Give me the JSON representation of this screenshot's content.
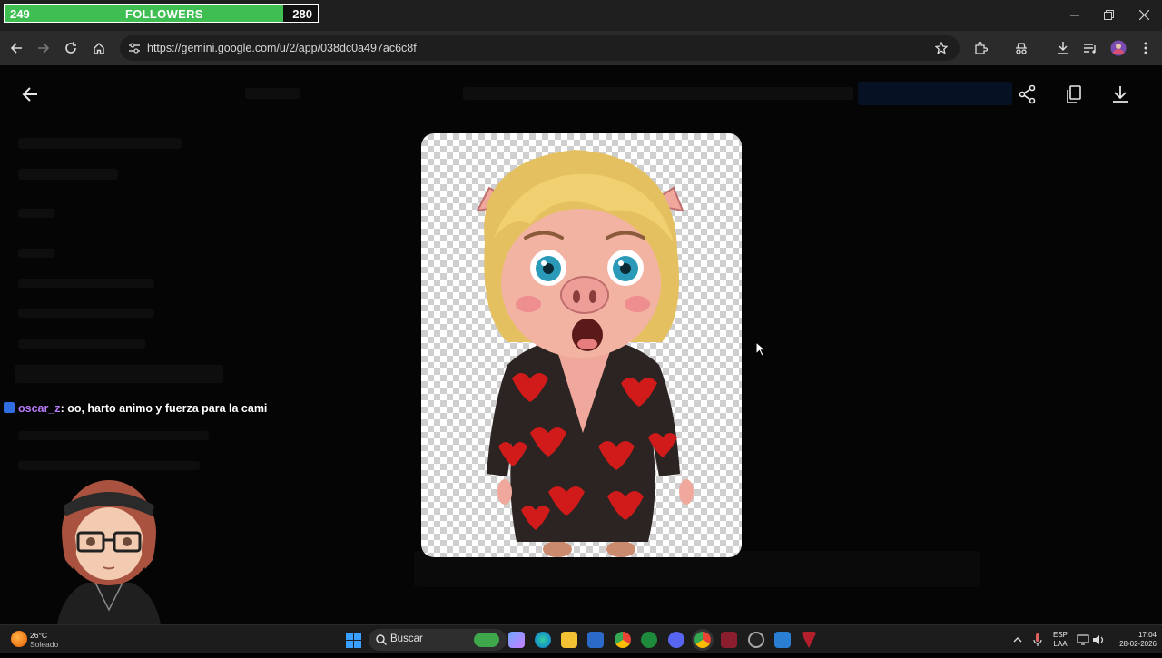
{
  "stream_overlay": {
    "followers_current": "249",
    "followers_label": "FOLLOWERS",
    "followers_goal": "280",
    "progress_fraction": 0.889,
    "bar_color": "#3fbf52"
  },
  "chat": {
    "username": "oscar_z",
    "message": ": oo, harto animo y fuerza para la cami",
    "username_color": "#b77bf6"
  },
  "browser": {
    "url": "https://gemini.google.com/u/2/app/038dc0a497ac6c8f",
    "icons": [
      "back-icon",
      "forward-icon",
      "reload-icon",
      "home-icon",
      "site-info-icon",
      "bookmark-star-icon",
      "extensions-icon",
      "incognito-icon",
      "download-icon",
      "media-icon",
      "profile-avatar-icon",
      "kebab-menu-icon"
    ]
  },
  "viewer": {
    "icons": [
      "back-arrow-icon",
      "share-icon",
      "copy-icon",
      "download-icon"
    ],
    "image_subject": "pig character sticker"
  },
  "taskbar": {
    "weather_temp": "26°C",
    "weather_desc": "Soleado",
    "search_placeholder": "Buscar",
    "lang_top": "ESP",
    "lang_bottom": "LAA",
    "time": "17:04",
    "date": "28-02-2026"
  }
}
